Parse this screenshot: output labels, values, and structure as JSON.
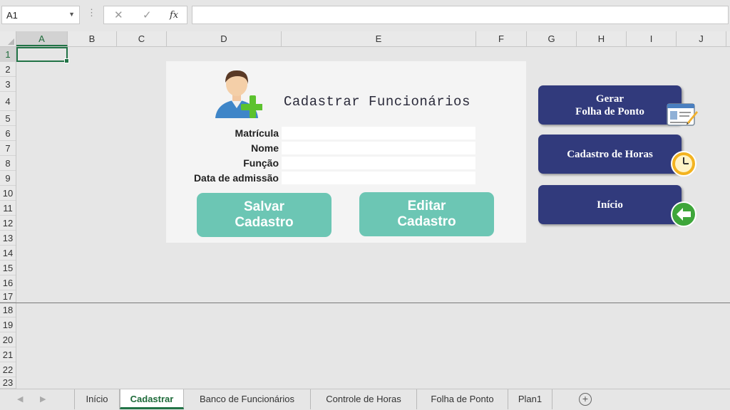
{
  "formula_bar": {
    "name_box": "A1",
    "cancel_symbol": "✕",
    "enter_symbol": "✓",
    "fx_label": "fx",
    "formula": ""
  },
  "columns": [
    "A",
    "B",
    "C",
    "D",
    "E",
    "F",
    "G",
    "H",
    "I",
    "J"
  ],
  "selected_column": "A",
  "rows": [
    "1",
    "2",
    "3",
    "4",
    "5",
    "6",
    "7",
    "8",
    "9",
    "10",
    "11",
    "12",
    "13",
    "14",
    "15",
    "16",
    "17",
    "18",
    "19",
    "20",
    "21",
    "22",
    "23"
  ],
  "selected_row": "1",
  "form": {
    "title": "Cadastrar Funcionários",
    "fields": [
      {
        "label": "Matrícula",
        "value": ""
      },
      {
        "label": "Nome",
        "value": ""
      },
      {
        "label": "Função",
        "value": ""
      },
      {
        "label": "Data de admissão",
        "value": ""
      }
    ],
    "save_button": "Salvar\nCadastro",
    "edit_button": "Editar\nCadastro"
  },
  "nav_buttons": [
    {
      "label": "Gerar\nFolha de Ponto",
      "icon": "id-card-icon"
    },
    {
      "label": "Cadastro de Horas",
      "icon": "clock-icon"
    },
    {
      "label": "Início",
      "icon": "back-arrow-icon"
    }
  ],
  "sheet_tabs": [
    "Início",
    "Cadastrar",
    "Banco de Funcionários",
    "Controle de Horas",
    "Folha de Ponto",
    "Plan1"
  ],
  "active_tab": "Cadastrar",
  "colors": {
    "accent_green": "#217346",
    "teal_button": "#6cc6b4",
    "navy_button": "#313a7c"
  }
}
